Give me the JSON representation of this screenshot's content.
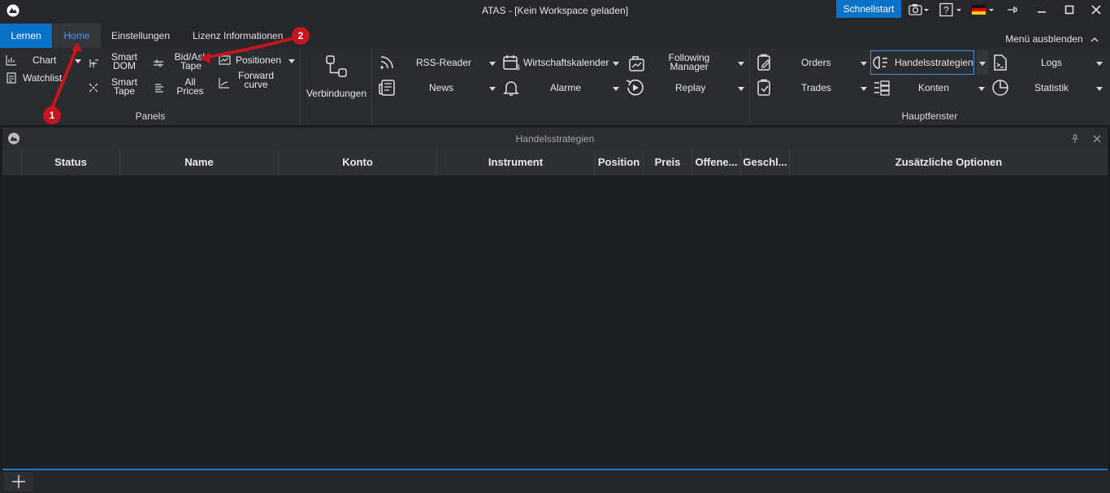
{
  "window": {
    "title": "ATAS - [Kein Workspace geladen]"
  },
  "titlebar": {
    "quickstart_label": "Schnellstart"
  },
  "tabs": [
    "Lernen",
    "Home",
    "Einstellungen",
    "Lizenz Informationen"
  ],
  "hide_menu_label": "Menü ausblenden",
  "ribbon": {
    "panels_group": {
      "label": "Panels",
      "chart": "Chart",
      "watchlist": "Watchlist",
      "smart_dom": [
        "Smart",
        "DOM"
      ],
      "smart_tape": [
        "Smart",
        "Tape"
      ],
      "bid_ask_tape": [
        "Bid/Ask",
        "Tape"
      ],
      "all_prices": [
        "All",
        "Prices"
      ],
      "positionen": "Positionen",
      "forward_curve": [
        "Forward",
        "curve"
      ]
    },
    "connections_label": "Verbindungen",
    "tools": {
      "rss_reader": "RSS-Reader",
      "news": "News",
      "wirtschaftskalender": "Wirtschaftskalender",
      "alarme": "Alarme",
      "following_manager": [
        "Following",
        "Manager"
      ],
      "replay": "Replay"
    },
    "main_window_group": {
      "label": "Hauptfenster",
      "orders": "Orders",
      "trades": "Trades",
      "handelsstrategien": "Handelsstrategien",
      "konten": "Konten",
      "logs": "Logs",
      "statistik": "Statistik"
    }
  },
  "panel": {
    "title": "Handelsstrategien",
    "columns": [
      "Status",
      "Name",
      "Konto",
      "Instrument",
      "Position",
      "Preis",
      "Offene...",
      "Geschl...",
      "Zusätzliche Optionen"
    ],
    "rows": []
  },
  "annotations": [
    "1",
    "2"
  ],
  "colors": {
    "accent": "#0a72c8",
    "annotation": "#c4161c",
    "background": "#1e1f21"
  }
}
